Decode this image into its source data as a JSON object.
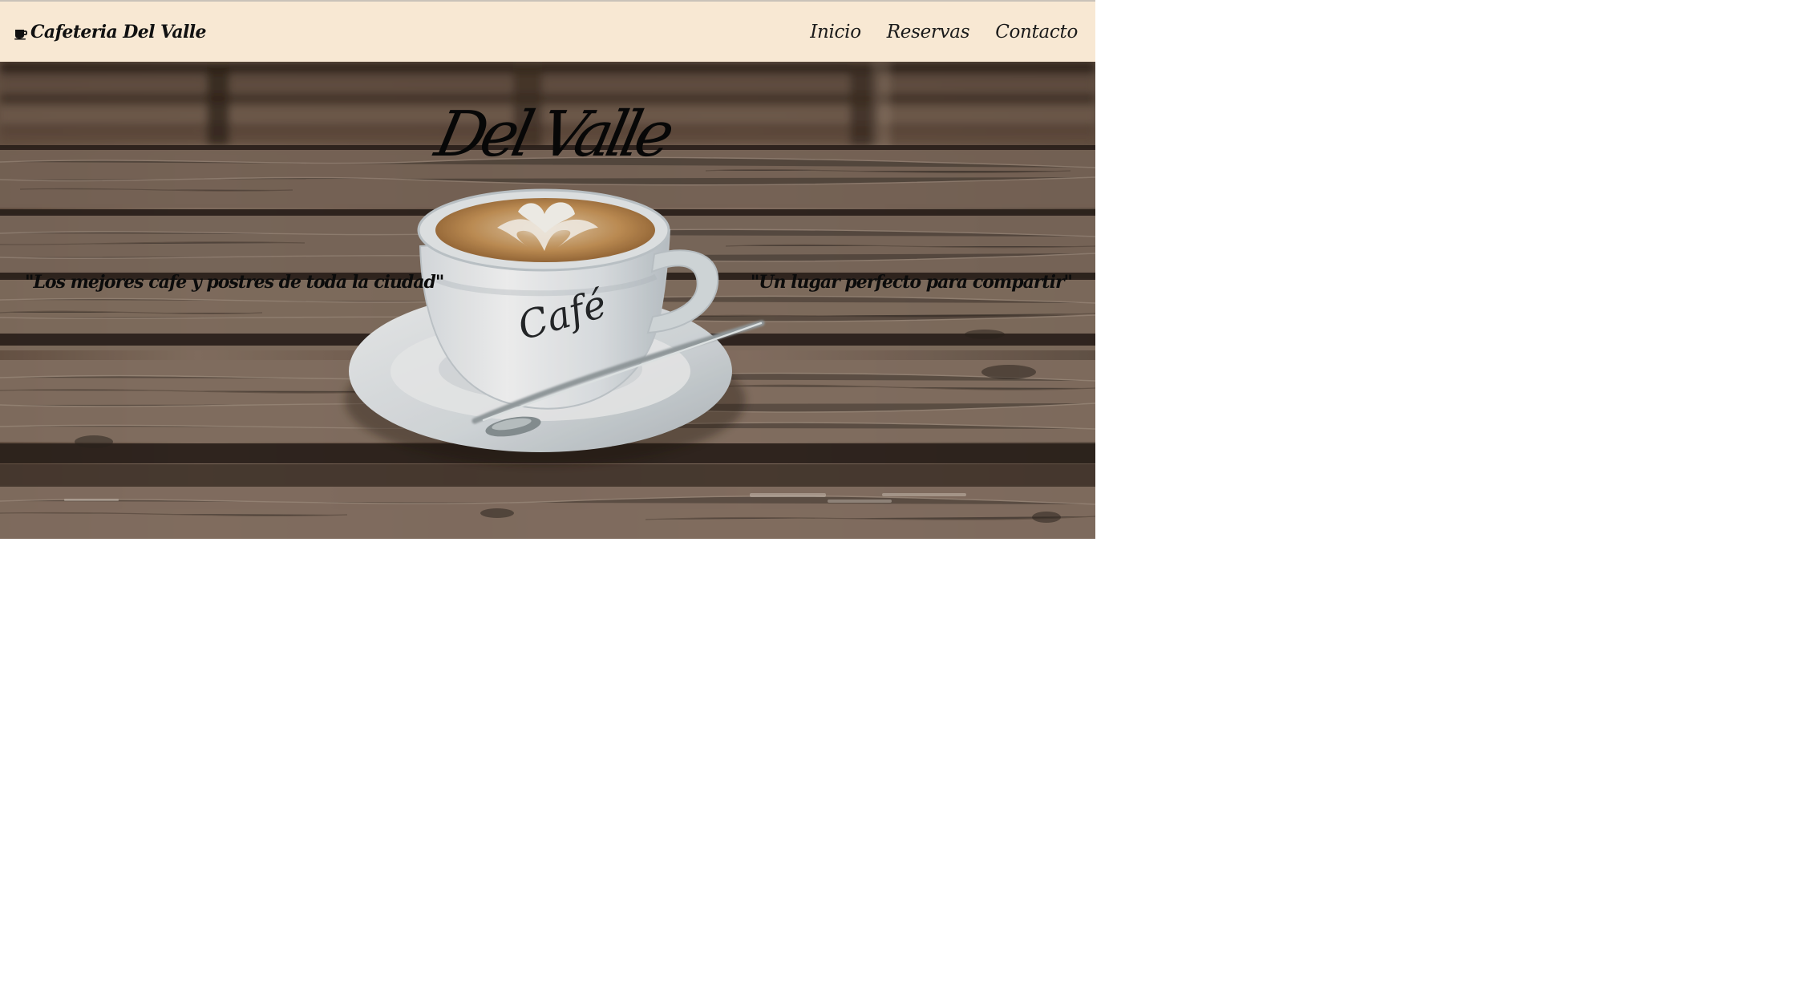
{
  "navbar": {
    "brand_label": "Cafeteria Del Valle",
    "brand_icon": "coffee-cup-icon",
    "links": [
      {
        "label": "Inicio"
      },
      {
        "label": "Reservas"
      },
      {
        "label": "Contacto"
      }
    ]
  },
  "hero": {
    "title": "Del Valle",
    "cup_text": "Café",
    "quote_left": "\"Los mejores cafe y postres de toda la ciudad\"",
    "quote_right": "\"Un lugar perfecto para compartir\""
  },
  "colors": {
    "navbar_bg": "#f8e8d3",
    "wood_dark": "#5d4a3c",
    "wood_light": "#8a7464",
    "text": "#0b0b0b"
  }
}
